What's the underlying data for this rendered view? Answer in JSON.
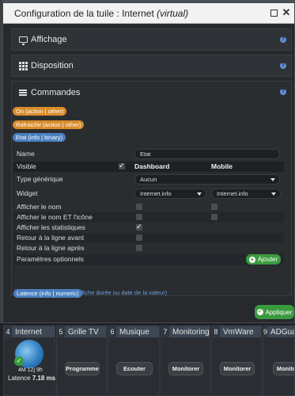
{
  "dialog": {
    "title_prefix": "Configuration de la tuile : ",
    "title_name": "Internet",
    "title_suffix": "(virtual)"
  },
  "sections": {
    "affichage": "Affichage",
    "disposition": "Disposition",
    "commandes": "Commandes",
    "help": "?"
  },
  "commands": {
    "badges": [
      "On (action | other)",
      "Rafraichir (action | other)",
      "Etat (info | binary)"
    ],
    "latence_badge": "Latence (info | numeric)"
  },
  "form": {
    "name_label": "Name",
    "name_value": "Etat",
    "visible_label": "Visible",
    "col_dashboard": "Dashboard",
    "col_mobile": "Mobile",
    "type_label": "Type générique",
    "type_value": "Aucun",
    "widget_label": "Widget",
    "widget_dashboard": "Internet.info",
    "widget_mobile": "Internet.info",
    "options": [
      "Afficher le nom",
      "Afficher le nom ET l'icône",
      "Afficher les statistiques",
      "Retour à la ligne avant",
      "Retour à la ligne après"
    ],
    "params_label": "Paramètres optionnels",
    "add_label": "Ajouter",
    "hint": "time : duration|date (Affiche durée ou date de la valeur)"
  },
  "footer": {
    "apply_label": "Appliquer"
  },
  "dashboard": {
    "tiles": [
      {
        "num": "4",
        "name": "Internet"
      },
      {
        "num": "5",
        "name": "Grille TV",
        "button": "Programme"
      },
      {
        "num": "6",
        "name": "Musique",
        "button": "Ecouter"
      },
      {
        "num": "7",
        "name": "Monitoring",
        "button": "Monitorer"
      },
      {
        "num": "8",
        "name": "VmWare",
        "button": "Monitorer"
      },
      {
        "num": "9",
        "name": "ADGuard",
        "button": "Monitorer"
      }
    ],
    "uptime": "4M 12j 9h",
    "latency_label": "Latence",
    "latency_value": "7.18 ms"
  },
  "colors": {
    "accent_green": "#3a9a3e",
    "badge_orange": "#d98c2a",
    "badge_blue": "#4a7fbf",
    "help_blue": "#5f8fd6"
  }
}
